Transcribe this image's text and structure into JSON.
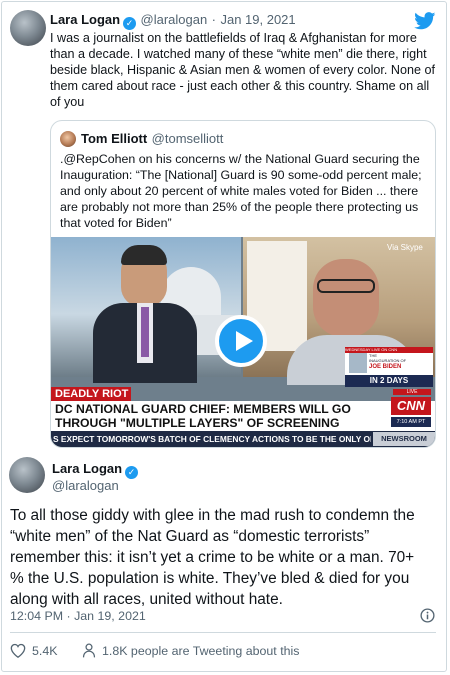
{
  "colors": {
    "accent": "#1d9bf0",
    "text": "#0f1419",
    "muted": "#536471",
    "border": "#cfd9de",
    "like_red": "#f91880"
  },
  "icons": {
    "top_right": "twitter-bird-icon",
    "info": "info-icon",
    "like": "heart-icon",
    "people": "person-icon",
    "play": "play-icon"
  },
  "header_tweet": {
    "name": "Lara Logan",
    "handle": "@laralogan",
    "separator": "·",
    "date": "Jan 19, 2021",
    "text": "I was a journalist on the battlefields of Iraq & Afghanistan for more than a decade. I watched many of these “white men” die there, right beside black, Hispanic & Asian men & women of every color. None of them cared about race - just each other & this country. Shame on all of you"
  },
  "quoted_tweet": {
    "name": "Tom Elliott",
    "handle": "@tomselliott",
    "text": ".@RepCohen on his concerns w/ the National Guard securing the Inauguration: “The [National] Guard is 90 some-odd percent male; and only about 20 percent of white males voted for Biden ... there are probably not more than 25% of the people there protecting us that voted for Biden”",
    "video": {
      "skype_label": "Via Skype",
      "lower_third_banner": "WEDNESDAY LIVE ON CNN",
      "lower_third_line1": "THE",
      "lower_third_line2": "INAUGURATION OF",
      "lower_third_line3": "JOE BIDEN",
      "lower_third_countdown": "IN 2 DAYS",
      "live_label": "LIVE",
      "network": "CNN",
      "time": "7:10 AM PT",
      "tag": "DEADLY RIOT",
      "headline_line1": "DC NATIONAL GUARD CHIEF: MEMBERS WILL GO",
      "headline_line2": "THROUGH \"MULTIPLE LAYERS\" OF SCREENING",
      "ticker": "S EXPECT TOMORROW'S BATCH OF CLEMENCY ACTIONS TO BE THE ONLY ON",
      "ticker_tag": "NEWSROOM"
    }
  },
  "main_tweet": {
    "name": "Lara Logan",
    "handle": "@laralogan",
    "text": "To all those giddy with glee in the mad rush to condemn the “white men” of the Nat Guard as  “domestic terrorists” remember this: it isn’t yet a crime to be white or a man. 70+ % the U.S. population is white. They’ve bled & died for you along with all races, united without hate.",
    "time": "12:04 PM",
    "date": "Jan 19, 2021",
    "likes": "5.4K",
    "people_tweeting": "1.8K people are Tweeting about this"
  }
}
